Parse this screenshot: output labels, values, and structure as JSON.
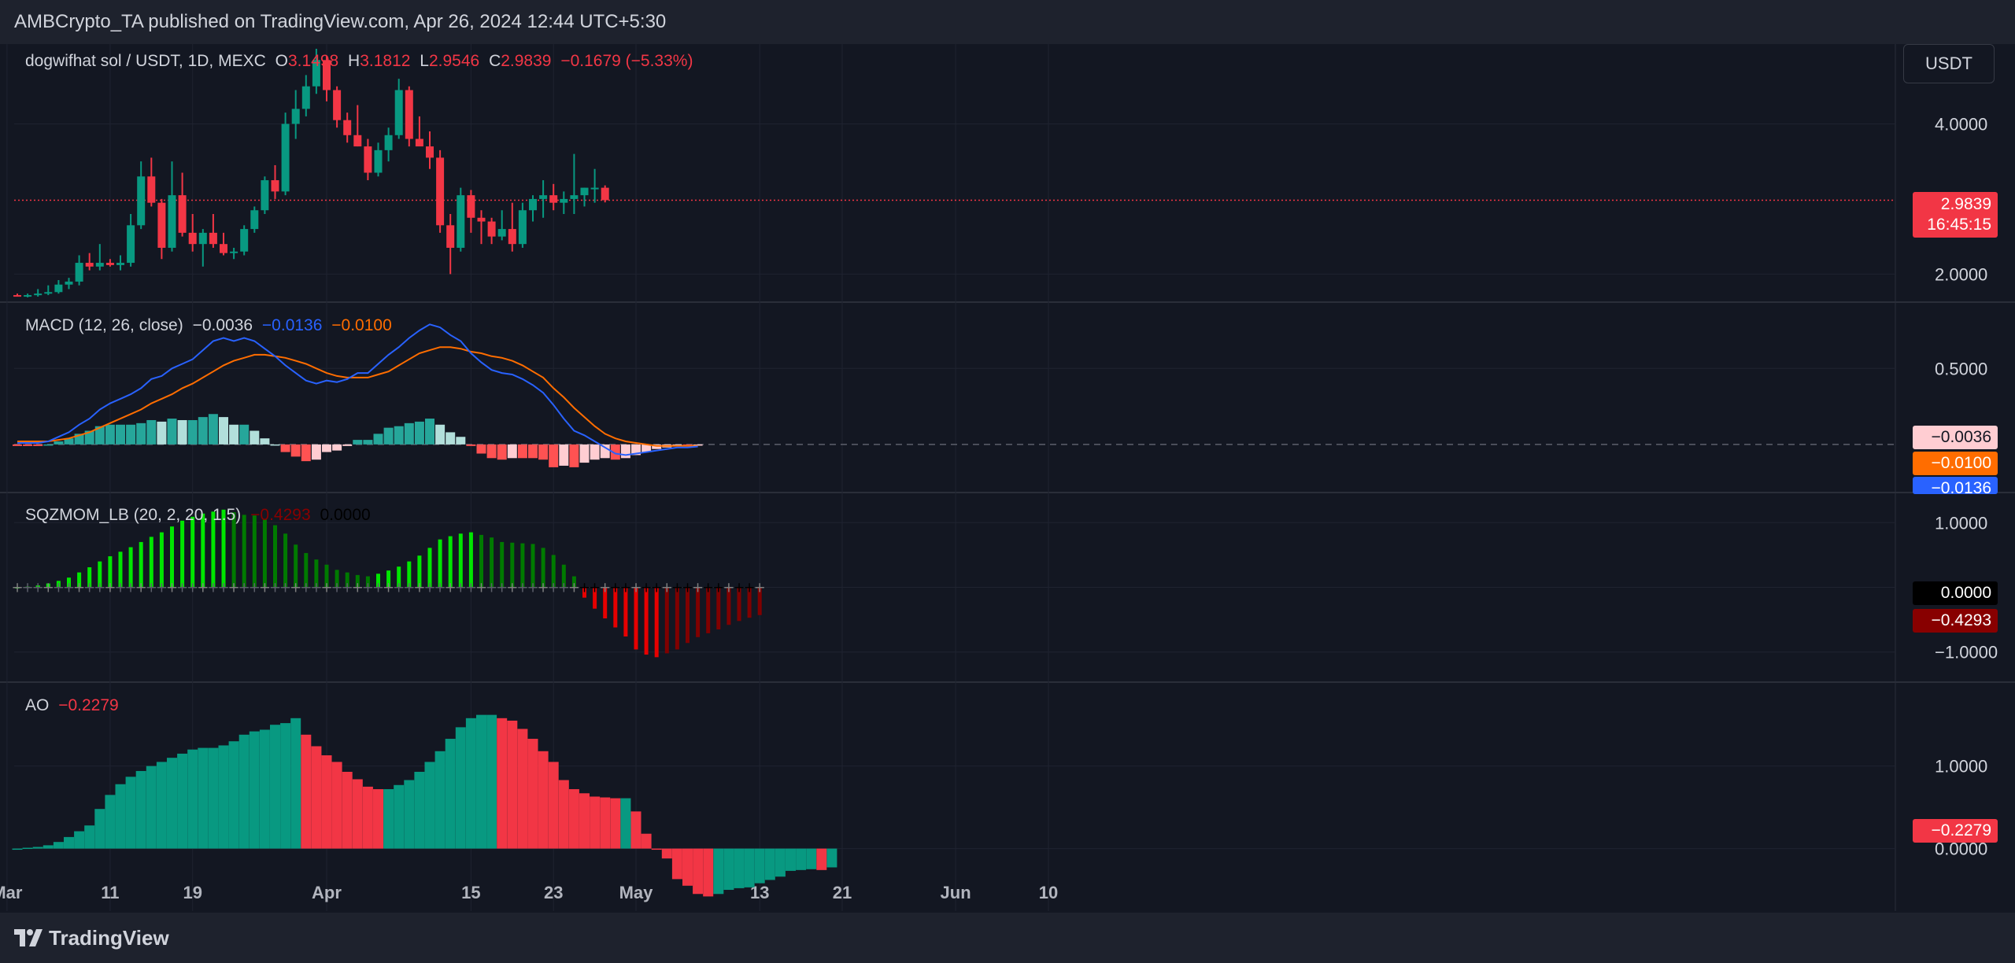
{
  "header": {
    "publisher_line": "AMBCrypto_TA published on TradingView.com, Apr 26, 2024 12:44 UTC+5:30"
  },
  "footer": {
    "brand": "TradingView"
  },
  "toolbar": {
    "currency": "USDT"
  },
  "colors": {
    "background": "#131722",
    "up": "#089981",
    "down": "#f23645",
    "macd_line": "#2962ff",
    "signal_line": "#ff6d00",
    "sqz_up_strong": "#00e600",
    "sqz_up_weak": "#007a00",
    "sqz_down_strong": "#e60000",
    "sqz_down_weak": "#800000",
    "ao_up": "#089981",
    "ao_down": "#f23645"
  },
  "legends": {
    "price": {
      "symbol": "dogwifhat sol / USDT, 1D, MEXC",
      "o_label": "O",
      "o_value": "3.1498",
      "h_label": "H",
      "h_value": "3.1812",
      "l_label": "L",
      "l_value": "2.9546",
      "c_label": "C",
      "c_value": "2.9839",
      "change": "−0.1679 (−5.33%)"
    },
    "macd": {
      "title": "MACD (12, 26, close)",
      "hist": "−0.0036",
      "macd": "−0.0136",
      "signal": "−0.0100"
    },
    "sqz": {
      "title": "SQZMOM_LB (20, 2, 20, 1.5)",
      "value": "−0.4293",
      "zero": "0.0000"
    },
    "ao": {
      "title": "AO",
      "value": "−0.2279"
    }
  },
  "price_tags": {
    "last_price": "2.9839",
    "countdown": "16:45:15",
    "macd_hist": "−0.0036",
    "macd_signal": "−0.0100",
    "macd_line": "−0.0136",
    "sqz_zero": "0.0000",
    "sqz_value": "−0.4293",
    "ao_value": "−0.2279"
  },
  "chart_data": [
    {
      "type": "candlestick",
      "title": "dogwifhat sol / USDT, 1D, MEXC",
      "y_ticks": [
        "4.0000",
        "2.0000"
      ],
      "ylim": [
        1.7,
        5.0
      ],
      "x_ticks": [
        {
          "label": "Mar",
          "index": -1
        },
        {
          "label": "11",
          "index": 9
        },
        {
          "label": "19",
          "index": 17
        },
        {
          "label": "Apr",
          "index": 30
        },
        {
          "label": "15",
          "index": 44
        },
        {
          "label": "23",
          "index": 52
        },
        {
          "label": "May",
          "index": 60
        },
        {
          "label": "13",
          "index": 72
        },
        {
          "label": "21",
          "index": 80
        },
        {
          "label": "Jun",
          "index": 91
        },
        {
          "label": "10",
          "index": 100
        }
      ],
      "last_close": 2.9839,
      "ohlc": [
        [
          1.72,
          1.74,
          1.7,
          1.71
        ],
        [
          1.71,
          1.74,
          1.69,
          1.72
        ],
        [
          1.72,
          1.8,
          1.7,
          1.74
        ],
        [
          1.74,
          1.85,
          1.72,
          1.76
        ],
        [
          1.76,
          1.92,
          1.74,
          1.86
        ],
        [
          1.86,
          1.95,
          1.8,
          1.9
        ],
        [
          1.9,
          2.25,
          1.85,
          2.15
        ],
        [
          2.15,
          2.28,
          2.05,
          2.1
        ],
        [
          2.1,
          2.4,
          2.05,
          2.15
        ],
        [
          2.15,
          2.2,
          2.1,
          2.12
        ],
        [
          2.12,
          2.25,
          2.05,
          2.15
        ],
        [
          2.15,
          2.8,
          2.1,
          2.65
        ],
        [
          2.65,
          3.5,
          2.6,
          3.3
        ],
        [
          3.3,
          3.55,
          2.9,
          2.95
        ],
        [
          2.95,
          3.0,
          2.2,
          2.35
        ],
        [
          2.35,
          3.5,
          2.3,
          3.05
        ],
        [
          3.05,
          3.35,
          2.5,
          2.55
        ],
        [
          2.55,
          2.8,
          2.3,
          2.4
        ],
        [
          2.4,
          2.6,
          2.1,
          2.55
        ],
        [
          2.55,
          2.8,
          2.35,
          2.4
        ],
        [
          2.4,
          2.55,
          2.25,
          2.28
        ],
        [
          2.28,
          2.35,
          2.2,
          2.3
        ],
        [
          2.3,
          2.65,
          2.25,
          2.6
        ],
        [
          2.6,
          2.9,
          2.55,
          2.85
        ],
        [
          2.85,
          3.3,
          2.8,
          3.25
        ],
        [
          3.25,
          3.45,
          3.0,
          3.1
        ],
        [
          3.1,
          4.15,
          3.05,
          4.0
        ],
        [
          4.0,
          4.45,
          3.8,
          4.2
        ],
        [
          4.2,
          4.65,
          4.1,
          4.5
        ],
        [
          4.5,
          5.0,
          4.4,
          4.85
        ],
        [
          4.85,
          4.9,
          4.3,
          4.45
        ],
        [
          4.45,
          4.5,
          3.95,
          4.05
        ],
        [
          4.05,
          4.15,
          3.75,
          3.85
        ],
        [
          3.85,
          4.25,
          3.7,
          3.7
        ],
        [
          3.7,
          3.8,
          3.25,
          3.35
        ],
        [
          3.35,
          3.75,
          3.3,
          3.65
        ],
        [
          3.65,
          3.95,
          3.5,
          3.85
        ],
        [
          3.85,
          4.6,
          3.8,
          4.45
        ],
        [
          4.45,
          4.5,
          3.7,
          3.8
        ],
        [
          3.8,
          4.1,
          3.75,
          3.7
        ],
        [
          3.7,
          3.9,
          3.4,
          3.55
        ],
        [
          3.55,
          3.65,
          2.55,
          2.65
        ],
        [
          2.65,
          2.8,
          2.0,
          2.35
        ],
        [
          2.35,
          3.15,
          2.3,
          3.05
        ],
        [
          3.05,
          3.12,
          2.55,
          2.75
        ],
        [
          2.75,
          2.85,
          2.4,
          2.7
        ],
        [
          2.7,
          2.75,
          2.4,
          2.5
        ],
        [
          2.5,
          2.85,
          2.45,
          2.6
        ],
        [
          2.6,
          2.95,
          2.3,
          2.4
        ],
        [
          2.4,
          2.95,
          2.35,
          2.85
        ],
        [
          2.85,
          3.05,
          2.7,
          3.0
        ],
        [
          3.0,
          3.25,
          2.75,
          3.05
        ],
        [
          3.05,
          3.2,
          2.85,
          2.95
        ],
        [
          2.95,
          3.1,
          2.8,
          3.0
        ],
        [
          3.0,
          3.6,
          2.8,
          3.05
        ],
        [
          3.05,
          3.15,
          2.9,
          3.15
        ],
        [
          3.15,
          3.4,
          2.95,
          3.15
        ],
        [
          3.1498,
          3.1812,
          2.9546,
          2.9839
        ]
      ]
    },
    {
      "type": "line",
      "title": "MACD (12, 26, close)",
      "y_ticks": [
        "0.5000"
      ],
      "ylim": [
        -0.28,
        0.9
      ],
      "series": [
        {
          "name": "MACD",
          "values": [
            0.01,
            0.01,
            0.01,
            0.02,
            0.05,
            0.08,
            0.13,
            0.17,
            0.23,
            0.27,
            0.3,
            0.33,
            0.37,
            0.43,
            0.45,
            0.5,
            0.53,
            0.56,
            0.62,
            0.68,
            0.7,
            0.68,
            0.7,
            0.68,
            0.63,
            0.58,
            0.52,
            0.47,
            0.42,
            0.4,
            0.42,
            0.41,
            0.43,
            0.47,
            0.47,
            0.53,
            0.59,
            0.64,
            0.7,
            0.75,
            0.79,
            0.77,
            0.72,
            0.68,
            0.6,
            0.54,
            0.49,
            0.47,
            0.46,
            0.43,
            0.39,
            0.34,
            0.26,
            0.17,
            0.09,
            0.06,
            0.02,
            -0.02,
            -0.06,
            -0.07,
            -0.06,
            -0.05,
            -0.04,
            -0.03,
            -0.02,
            -0.02,
            -0.0136
          ]
        },
        {
          "name": "Signal",
          "values": [
            0.02,
            0.02,
            0.02,
            0.02,
            0.03,
            0.04,
            0.06,
            0.08,
            0.11,
            0.14,
            0.17,
            0.2,
            0.23,
            0.27,
            0.3,
            0.33,
            0.37,
            0.4,
            0.44,
            0.48,
            0.52,
            0.55,
            0.57,
            0.59,
            0.59,
            0.58,
            0.57,
            0.55,
            0.53,
            0.5,
            0.47,
            0.45,
            0.44,
            0.44,
            0.44,
            0.46,
            0.48,
            0.52,
            0.56,
            0.6,
            0.62,
            0.64,
            0.64,
            0.63,
            0.61,
            0.6,
            0.58,
            0.57,
            0.55,
            0.52,
            0.48,
            0.44,
            0.37,
            0.31,
            0.24,
            0.18,
            0.12,
            0.07,
            0.04,
            0.02,
            0.01,
            0.0,
            -0.01,
            -0.01,
            -0.01,
            -0.01,
            -0.01
          ]
        },
        {
          "name": "Histogram",
          "values": [
            -0.01,
            -0.01,
            -0.01,
            0.0,
            0.02,
            0.04,
            0.07,
            0.09,
            0.12,
            0.13,
            0.13,
            0.13,
            0.14,
            0.16,
            0.15,
            0.17,
            0.16,
            0.16,
            0.18,
            0.2,
            0.18,
            0.13,
            0.13,
            0.09,
            0.04,
            0.0,
            -0.05,
            -0.08,
            -0.11,
            -0.1,
            -0.05,
            -0.04,
            -0.01,
            0.03,
            0.03,
            0.07,
            0.11,
            0.12,
            0.14,
            0.15,
            0.17,
            0.13,
            0.08,
            0.05,
            -0.01,
            -0.06,
            -0.09,
            -0.1,
            -0.09,
            -0.09,
            -0.09,
            -0.1,
            -0.15,
            -0.14,
            -0.15,
            -0.12,
            -0.1,
            -0.09,
            -0.1,
            -0.09,
            -0.07,
            -0.05,
            -0.03,
            -0.02,
            -0.01,
            -0.01,
            -0.0036
          ]
        }
      ]
    },
    {
      "type": "bar",
      "title": "SQZMOM_LB (20, 2, 20, 1.5)",
      "y_ticks": [
        "1.0000",
        "0.0000",
        "−1.0000"
      ],
      "ylim": [
        -1.38,
        1.38
      ],
      "values": [
        0.0,
        0.01,
        0.03,
        0.06,
        0.1,
        0.15,
        0.23,
        0.31,
        0.4,
        0.48,
        0.55,
        0.62,
        0.7,
        0.78,
        0.85,
        0.94,
        1.03,
        1.09,
        1.14,
        1.17,
        1.2,
        1.16,
        1.12,
        1.11,
        1.05,
        0.96,
        0.83,
        0.66,
        0.53,
        0.43,
        0.35,
        0.27,
        0.23,
        0.19,
        0.17,
        0.21,
        0.26,
        0.32,
        0.4,
        0.49,
        0.61,
        0.74,
        0.79,
        0.83,
        0.85,
        0.81,
        0.77,
        0.7,
        0.69,
        0.68,
        0.67,
        0.61,
        0.5,
        0.35,
        0.17,
        -0.16,
        -0.33,
        -0.48,
        -0.62,
        -0.76,
        -0.96,
        -1.04,
        -1.08,
        -1.02,
        -0.96,
        -0.86,
        -0.77,
        -0.71,
        -0.65,
        -0.58,
        -0.52,
        -0.47,
        -0.4293
      ]
    },
    {
      "type": "bar",
      "title": "AO",
      "y_ticks": [
        "1.0000",
        "0.0000"
      ],
      "ylim": [
        -0.7,
        1.95
      ],
      "values": [
        0.0,
        0.01,
        0.02,
        0.04,
        0.08,
        0.14,
        0.21,
        0.28,
        0.48,
        0.65,
        0.78,
        0.87,
        0.94,
        1.0,
        1.05,
        1.1,
        1.15,
        1.2,
        1.22,
        1.22,
        1.25,
        1.3,
        1.38,
        1.42,
        1.44,
        1.5,
        1.52,
        1.58,
        1.38,
        1.24,
        1.13,
        1.05,
        0.93,
        0.84,
        0.75,
        0.72,
        0.72,
        0.77,
        0.83,
        0.93,
        1.05,
        1.18,
        1.33,
        1.47,
        1.58,
        1.62,
        1.62,
        1.58,
        1.55,
        1.45,
        1.33,
        1.18,
        1.05,
        0.83,
        0.72,
        0.67,
        0.63,
        0.62,
        0.61,
        0.61,
        0.45,
        0.18,
        0.0,
        -0.12,
        -0.37,
        -0.45,
        -0.55,
        -0.58,
        -0.55,
        -0.5,
        -0.48,
        -0.47,
        -0.42,
        -0.38,
        -0.34,
        -0.27,
        -0.26,
        -0.25,
        -0.26,
        -0.2279
      ]
    }
  ]
}
